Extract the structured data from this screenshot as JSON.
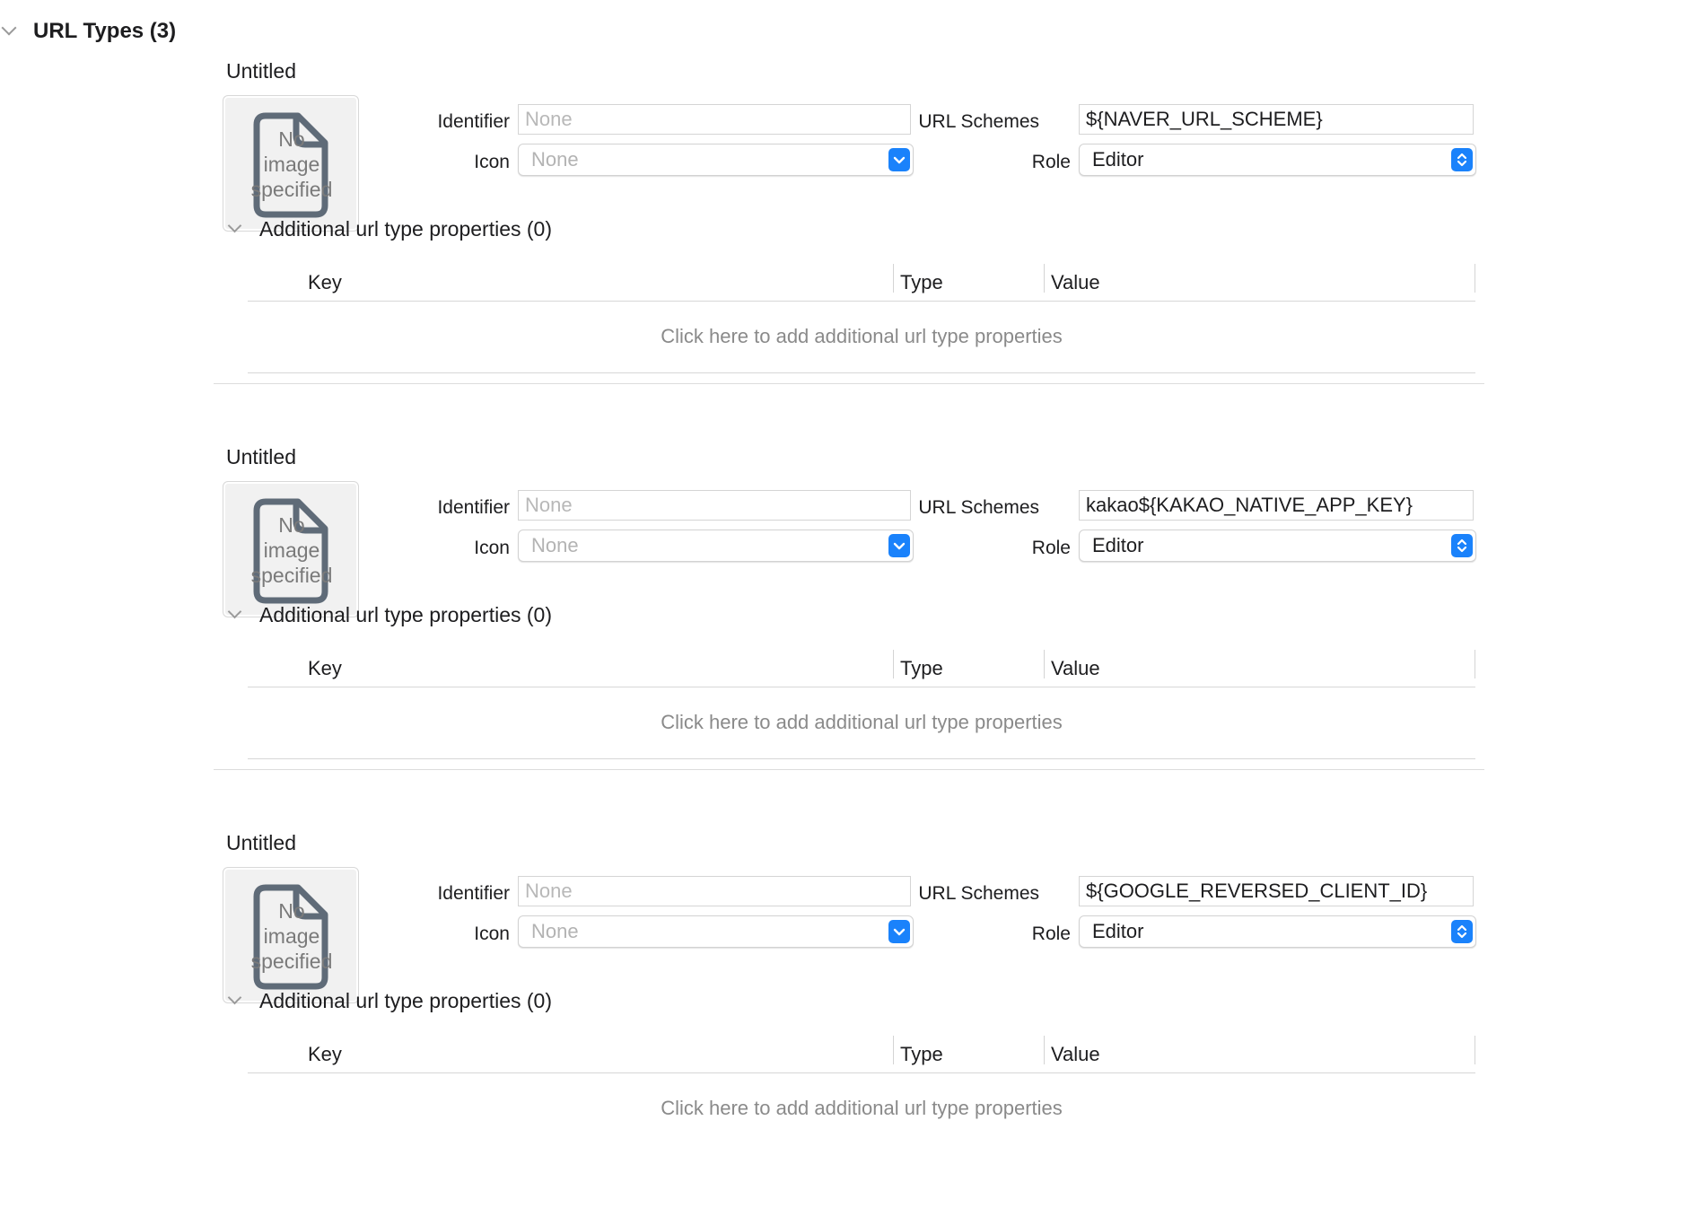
{
  "section": {
    "title": "URL Types (3)"
  },
  "labels": {
    "identifier": "Identifier",
    "icon": "Icon",
    "url_schemes": "URL Schemes",
    "role": "Role",
    "no_image_line1": "No",
    "no_image_line2": "image",
    "no_image_line3": "specified",
    "additional_properties": "Additional url type properties (0)",
    "col_key": "Key",
    "col_type": "Type",
    "col_value": "Value",
    "add_hint": "Click here to add additional url type properties"
  },
  "entries": [
    {
      "title": "Untitled",
      "identifier_value": "",
      "identifier_placeholder": "None",
      "icon_selected": "None",
      "url_schemes": "${NAVER_URL_SCHEME}",
      "role": "Editor"
    },
    {
      "title": "Untitled",
      "identifier_value": "",
      "identifier_placeholder": "None",
      "icon_selected": "None",
      "url_schemes": "kakao${KAKAO_NATIVE_APP_KEY}",
      "role": "Editor"
    },
    {
      "title": "Untitled",
      "identifier_value": "",
      "identifier_placeholder": "None",
      "icon_selected": "None",
      "url_schemes": "${GOOGLE_REVERSED_CLIENT_ID}",
      "role": "Editor"
    }
  ],
  "colors": {
    "accent": "#1a82fb",
    "icon_gray": "#5f6b78"
  },
  "icons": {
    "section_toggle": "chevron-down-icon",
    "no_image": "document-icon",
    "popup_arrows": "popup-arrows-icon"
  }
}
